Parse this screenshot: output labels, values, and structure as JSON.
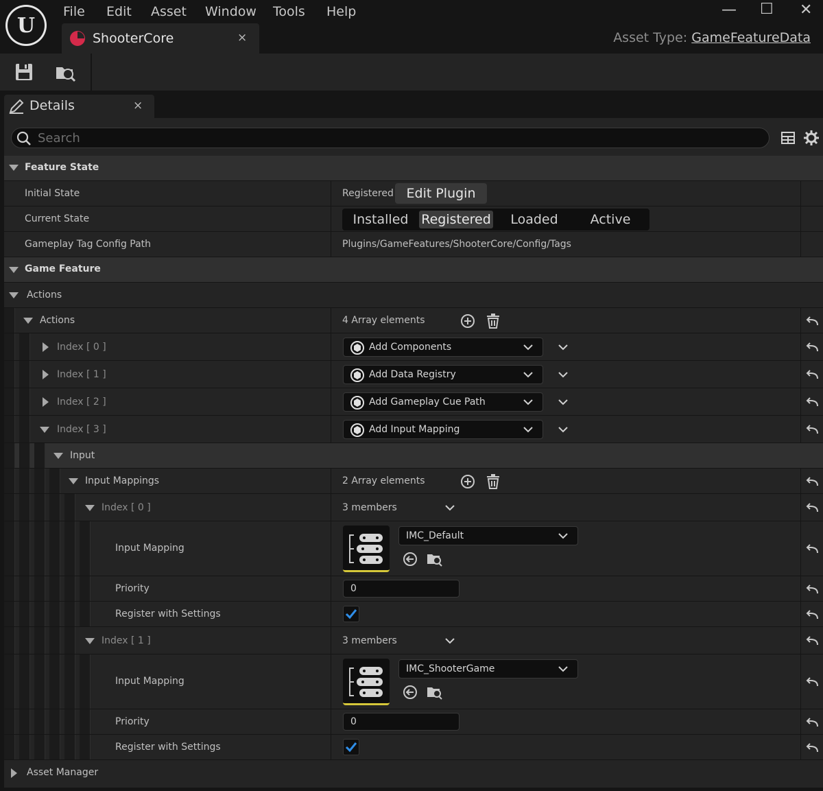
{
  "menu": [
    "File",
    "Edit",
    "Asset",
    "Window",
    "Tools",
    "Help"
  ],
  "doc_tab": {
    "label": "ShooterCore",
    "close": "×"
  },
  "window_controls": {
    "minimize": "—",
    "maximize": "☐",
    "close": "✕"
  },
  "asset_type": {
    "label": "Asset Type:",
    "value": "GameFeatureData"
  },
  "toolbar": {
    "icons": [
      "save-icon",
      "browse-icon"
    ]
  },
  "details_tab": {
    "label": "Details",
    "close": "×"
  },
  "search": {
    "placeholder": "Search"
  },
  "feature_state": {
    "title": "Feature State",
    "initial_state": {
      "label": "Initial State",
      "value": "Registered",
      "button": "Edit Plugin"
    },
    "current_state": {
      "label": "Current State",
      "options": [
        "Installed",
        "Registered",
        "Loaded",
        "Active"
      ],
      "selected": "Registered"
    },
    "tag_config": {
      "label": "Gameplay Tag Config Path",
      "value": "Plugins/GameFeatures/ShooterCore/Config/Tags"
    }
  },
  "game_feature": {
    "title": "Game Feature",
    "actions_group": "Actions",
    "actions": {
      "label": "Actions",
      "count": "4 Array elements",
      "items": [
        {
          "index": "Index [ 0 ]",
          "value": "Add Components"
        },
        {
          "index": "Index [ 1 ]",
          "value": "Add Data Registry"
        },
        {
          "index": "Index [ 2 ]",
          "value": "Add Gameplay Cue Path"
        },
        {
          "index": "Index [ 3 ]",
          "value": "Add Input Mapping"
        }
      ]
    },
    "input": {
      "label": "Input",
      "mappings_label": "Input Mappings",
      "mappings_count": "2 Array elements",
      "entries": [
        {
          "index": "Index [ 0 ]",
          "members": "3 members",
          "mapping_label": "Input Mapping",
          "mapping_value": "IMC_Default",
          "priority_label": "Priority",
          "priority_value": "0",
          "register_label": "Register with Settings"
        },
        {
          "index": "Index [ 1 ]",
          "members": "3 members",
          "mapping_label": "Input Mapping",
          "mapping_value": "IMC_ShooterGame",
          "priority_label": "Priority",
          "priority_value": "0",
          "register_label": "Register with Settings"
        }
      ]
    }
  },
  "asset_manager": {
    "title": "Asset Manager"
  },
  "colors": {
    "accent": "#d42a4a",
    "check": "#2f8ee8",
    "thumb_underline": "#d6c83a"
  }
}
